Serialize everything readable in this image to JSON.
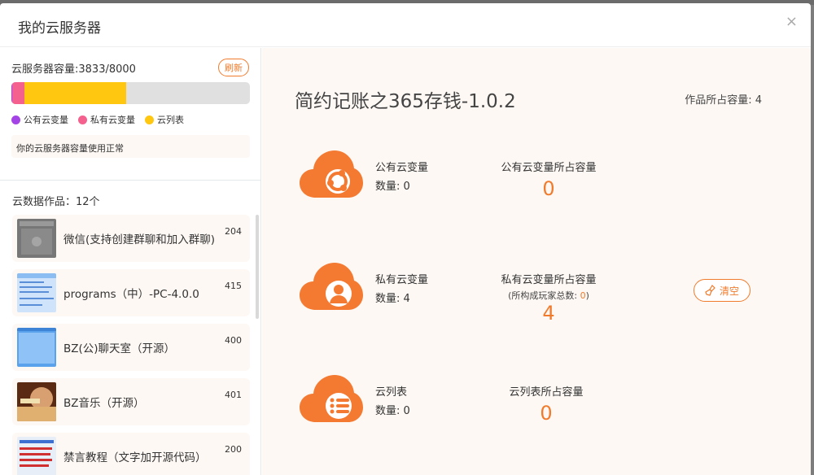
{
  "modal": {
    "title": "我的云服务器",
    "close_icon": "×"
  },
  "capacity": {
    "label": "云服务器容量:3833/8000",
    "used": 3833,
    "total": 8000,
    "refresh_label": "刷新",
    "segments": [
      {
        "name": "公有云变量",
        "color": "#a544e6",
        "fraction": 0.005
      },
      {
        "name": "私有云变量",
        "color": "#f4618f",
        "fraction": 0.05
      },
      {
        "name": "云列表",
        "color": "#ffc710",
        "fraction": 0.425
      }
    ],
    "legend": [
      "公有云变量",
      "私有云变量",
      "云列表"
    ],
    "status": "你的云服务器容量使用正常"
  },
  "works": {
    "title": "云数据作品：12个",
    "items": [
      {
        "name": "微信(支持创建群聊和加入群聊)",
        "size": "204"
      },
      {
        "name": "programs（中）-PC-4.0.0",
        "size": "415"
      },
      {
        "name": "BZ(公)聊天室（开源）",
        "size": "400"
      },
      {
        "name": "BZ音乐（开源）",
        "size": "401"
      },
      {
        "name": "禁言教程（文字加开源代码）",
        "size": "200"
      }
    ]
  },
  "detail": {
    "title": "简约记账之365存钱-1.0.2",
    "capacity": "作品所占容量: 4",
    "public": {
      "name": "公有云变量",
      "count": "数量: 0",
      "cap_label": "公有云变量所占容量",
      "cap_value": "0"
    },
    "private": {
      "name": "私有云变量",
      "count": "数量: 4",
      "cap_label": "私有云变量所占容量",
      "sub_prefix": "(所构成玩家总数: ",
      "sub_value": "0",
      "sub_suffix": ")",
      "cap_value": "4",
      "clear_label": "清空"
    },
    "list": {
      "name": "云列表",
      "count": "数量: 0",
      "cap_label": "云列表所占容量",
      "cap_value": "0"
    }
  },
  "colors": {
    "accent": "#f07b2c",
    "cloud": "#f47a32"
  }
}
